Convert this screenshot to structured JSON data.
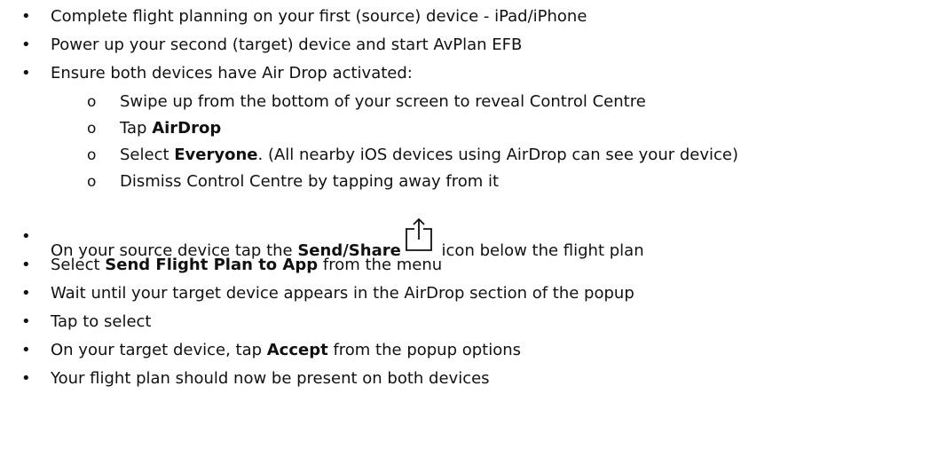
{
  "bullets": {
    "bullet_char": "•",
    "sub_bullet_char": "o"
  },
  "steps": [
    {
      "text": "Complete flight planning on your first (source) device - iPad/iPhone"
    },
    {
      "text": "Power up your second (target) device and start AvPlan EFB"
    },
    {
      "text": "Ensure both devices have Air Drop activated:"
    }
  ],
  "airdrop_substeps": {
    "s1": "Swipe up from the bottom of your screen to reveal Control Centre",
    "s2_prefix": "Tap ",
    "s2_bold": "AirDrop",
    "s3_prefix": "Select ",
    "s3_bold": "Everyone",
    "s3_suffix": ". (All nearby iOS devices using AirDrop can see your device)",
    "s4": "Dismiss Control Centre by tapping away from it"
  },
  "later_steps": {
    "share_prefix": "On your source device tap the ",
    "share_bold": "Send/Share",
    "share_icon": "share-icon",
    "share_suffix": " icon below the flight plan",
    "send_prefix": "Select ",
    "send_bold": "Send Flight Plan to App",
    "send_suffix": " from the menu",
    "wait": "Wait until your target device appears in the AirDrop section of the popup",
    "tap": "Tap to select",
    "accept_prefix": "On your target device, tap ",
    "accept_bold": "Accept",
    "accept_suffix": " from the popup options",
    "final": "Your flight plan should now be present on both devices"
  }
}
